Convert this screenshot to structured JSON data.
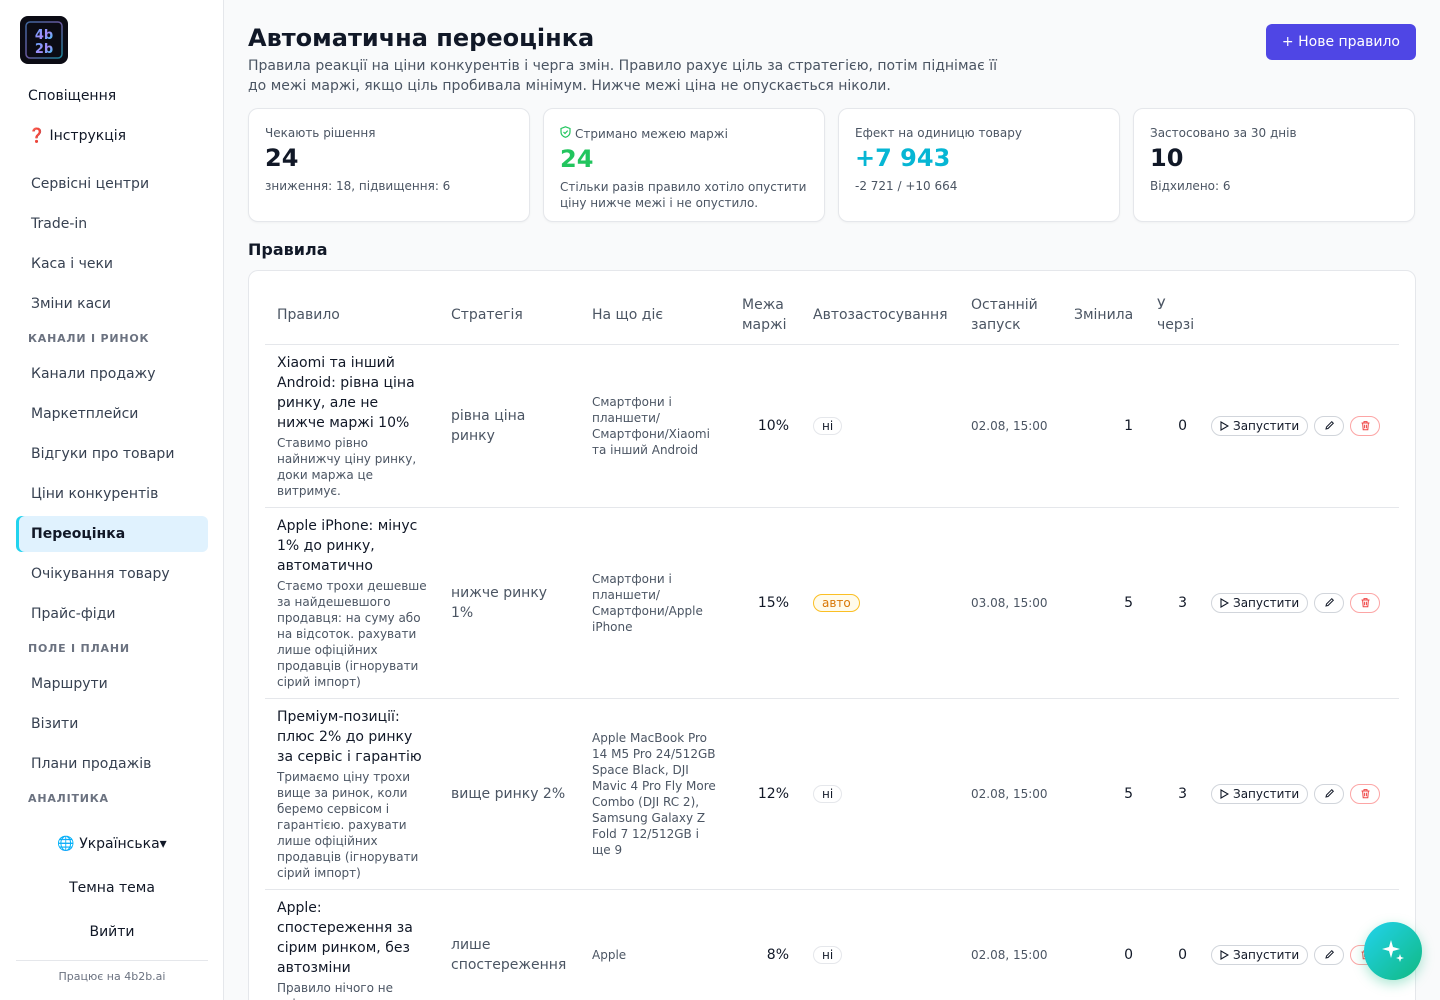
{
  "sidebar": {
    "top_items": [
      {
        "label": "Сповіщення"
      },
      {
        "label": "Інструкція"
      }
    ],
    "group1": [
      "Сервісні центри",
      "Trade-in",
      "Каса і чеки",
      "Зміни каси"
    ],
    "section_channels": "КАНАЛИ І РИНОК",
    "group2": [
      "Канали продажу",
      "Маркетплейси",
      "Відгуки про товари",
      "Ціни конкурентів",
      "Переоцінка",
      "Очікування товару",
      "Прайс-фіди"
    ],
    "section_field": "ПОЛЕ І ПЛАНИ",
    "group3": [
      "Маршрути",
      "Візити",
      "Плани продажів"
    ],
    "section_analytics": "АНАЛІТИКА",
    "language": "Українська",
    "theme": "Темна тема",
    "logout": "Вийти",
    "powered": "Працює на 4b2b.ai"
  },
  "header": {
    "title": "Автоматична переоцінка",
    "description": "Правила реакції на ціни конкурентів і черга змін. Правило рахує ціль за стратегією, потім піднімає її до межі маржі, якщо ціль пробивала мінімум. Нижче межі ціна не опускається ніколи.",
    "new_rule": "+ Нове правило"
  },
  "stats": [
    {
      "label": "Чекають рішення",
      "value": "24",
      "sub": "зниження: 18, підвищення: 6"
    },
    {
      "label": "Стримано межею маржі",
      "value": "24",
      "sub": "Стільки разів правило хотіло опустити ціну нижче межі і не опустило."
    },
    {
      "label": "Ефект на одиницю товару",
      "value": "+7 943",
      "sub": "-2 721 / +10 664"
    },
    {
      "label": "Застосовано за 30 днів",
      "value": "10",
      "sub": "Відхилено: 6"
    }
  ],
  "rules_title": "Правила",
  "table": {
    "headers": [
      "Правило",
      "Стратегія",
      "На що діє",
      "Межа маржі",
      "Автозастосування",
      "Останній запуск",
      "Змінила",
      "У черзі"
    ],
    "run_label": "Запустити",
    "rows": [
      {
        "name": "Xiaomi та інший Android: рівна ціна ринку, але не нижче маржі 10%",
        "desc": "Ставимо рівно найнижчу ціну ринку, доки маржа це витримує.",
        "strategy": "рівна ціна ринку",
        "scope": "Смартфони і планшети/ Смартфони/Xiaomi та інший Android",
        "margin": "10%",
        "auto": "ні",
        "last_run": "02.08, 15:00",
        "changed": "1",
        "queued": "0"
      },
      {
        "name": "Apple iPhone: мінус 1% до ринку, автоматично",
        "desc": "Стаємо трохи дешевше за найдешевшого продавця: на суму або на відсоток. рахувати лише офіційних продавців (ігнорувати сірий імпорт)",
        "strategy": "нижче ринку 1%",
        "scope": "Смартфони і планшети/ Смартфони/Apple iPhone",
        "margin": "15%",
        "auto": "авто",
        "last_run": "03.08, 15:00",
        "changed": "5",
        "queued": "3"
      },
      {
        "name": "Преміум-позиції: плюс 2% до ринку за сервіс і гарантію",
        "desc": "Тримаємо ціну трохи вище за ринок, коли беремо сервісом і гарантією. рахувати лише офіційних продавців (ігнорувати сірий імпорт)",
        "strategy": "вище ринку 2%",
        "scope": "Apple MacBook Pro 14 M5 Pro 24/512GB Space Black, DJI Mavic 4 Pro Fly More Combo (DJI RC 2), Samsung Galaxy Z Fold 7 12/512GB і ще 9",
        "margin": "12%",
        "auto": "ні",
        "last_run": "02.08, 15:00",
        "changed": "5",
        "queued": "3"
      },
      {
        "name": "Apple: спостереження за сірим ринком, без автозміни",
        "desc": "Правило нічого не змінює, лише тримає",
        "strategy": "лише спостереження",
        "scope": "Apple",
        "margin": "8%",
        "auto": "ні",
        "last_run": "02.08, 15:00",
        "changed": "0",
        "queued": "0"
      }
    ]
  },
  "colors": {
    "accent": "#4f46e5",
    "green": "#22c55e",
    "teal": "#06b6d4",
    "auto": "#d97706"
  },
  "icons": [
    "logo-icon",
    "question-icon",
    "shield-check-icon",
    "globe-icon",
    "play-icon",
    "pencil-icon",
    "trash-icon",
    "sparkles-icon"
  ]
}
